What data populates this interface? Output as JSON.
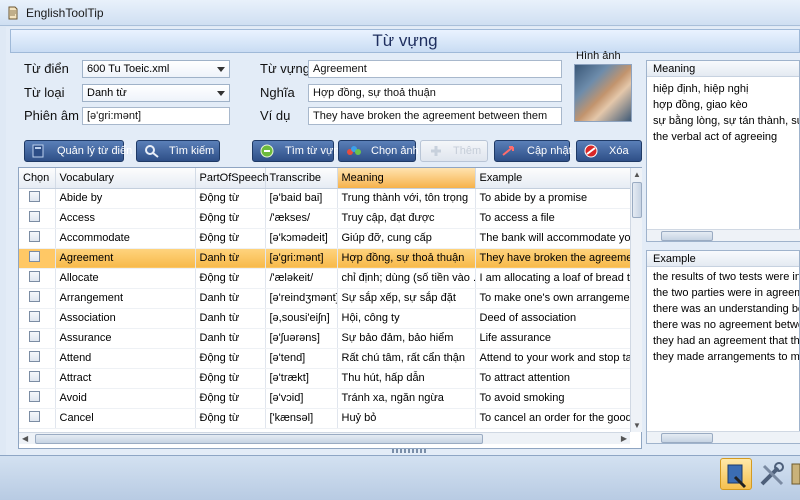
{
  "window": {
    "title": "EnglishToolTip"
  },
  "header": {
    "title": "Từ vựng"
  },
  "form": {
    "dictionary_label": "Từ điển",
    "dictionary_value": "600 Tu Toeic.xml",
    "wordtype_label": "Từ loại",
    "wordtype_value": "Danh từ",
    "phonetic_label": "Phiên âm",
    "phonetic_value": "[ə'gri:mənt]",
    "vocab_label": "Từ vựng",
    "vocab_value": "Agreement",
    "meaning_label": "Nghĩa",
    "meaning_value": "Hợp đồng, sự thoả thuận",
    "example_label": "Ví dụ",
    "example_value": "They have broken the agreement between them",
    "image_label": "Hình ảnh"
  },
  "buttons": {
    "manage_dict": "Quản lý từ điển",
    "search": "Tìm kiếm",
    "find_vocab": "Tìm từ vựng",
    "choose_image": "Chọn ảnh",
    "add": "Thêm",
    "update": "Cập nhật",
    "delete": "Xóa"
  },
  "table": {
    "columns": [
      "Chọn",
      "Vocabulary",
      "PartOfSpeech",
      "Transcribe",
      "Meaning",
      "Example"
    ],
    "rows": [
      [
        "",
        "Abide by",
        "Động từ",
        "[ə'baid bai]",
        "Trung thành với, tôn trọng",
        "To abide by a promise"
      ],
      [
        "",
        "Access",
        "Động từ",
        "/'ækses/",
        "Truy cập, đạt được",
        "To access a file"
      ],
      [
        "",
        "Accommodate",
        "Động từ",
        "[ə'kɔmədeit]",
        "Giúp đỡ, cung cấp",
        "The bank will accommodate you w"
      ],
      [
        "",
        "Agreement",
        "Danh từ",
        "[ə'gri:mənt]",
        "Hợp đồng, sự thoả thuận",
        "They have broken the agreement"
      ],
      [
        "",
        "Allocate",
        "Động từ",
        "/'æləkeit/",
        "chỉ định; dùng (số tiền vào ...",
        "I am allocating a loaf of bread to e"
      ],
      [
        "",
        "Arrangement",
        "Danh từ",
        "[ə'reindʒmənt]",
        "Sự sắp xếp, sự sắp đặt",
        "To make one's own arrangements"
      ],
      [
        "",
        "Association",
        "Danh từ",
        "[ə,sousi'eiʃn]",
        "Hội, công ty",
        "Deed of association"
      ],
      [
        "",
        "Assurance",
        "Danh từ",
        "[ə'ʃuərəns]",
        "Sự bảo đảm, bảo hiểm",
        "Life assurance"
      ],
      [
        "",
        "Attend",
        "Động từ",
        "[ə'tend]",
        "Rất chú tâm, rất cẩn thận",
        "Attend to your work and stop talki"
      ],
      [
        "",
        "Attract",
        "Động từ",
        "[ə'trækt]",
        "Thu hút, hấp dẫn",
        "To attract attention"
      ],
      [
        "",
        "Avoid",
        "Động từ",
        "[ə'vɔid]",
        "Tránh xa, ngăn ngừa",
        "To avoid smoking"
      ],
      [
        "",
        "Cancel",
        "Động từ",
        "['kænsəl]",
        "Huỷ bỏ",
        "To cancel an order for the goods"
      ]
    ],
    "selected_index": 3
  },
  "meaning_panel": {
    "title": "Meaning",
    "lines": [
      "hiệp định, hiệp nghị",
      "hợp đồng, giao kèo",
      "sự bằng lòng, sự tán thành, sự đồng",
      "the verbal act of agreeing"
    ]
  },
  "example_panel": {
    "title": "Example",
    "lines": [
      "the results of two tests were in cor",
      "the two parties were in agreement",
      "there was an understanding betwe",
      "there was no agreement between t",
      "they had an agreement that they w",
      "they made arrangements to meet ir"
    ]
  },
  "icons": {
    "app": "app-icon",
    "tool1": "lookup-tool-icon",
    "tool2": "settings-tools-icon",
    "tool3": "more-tool-icon"
  }
}
